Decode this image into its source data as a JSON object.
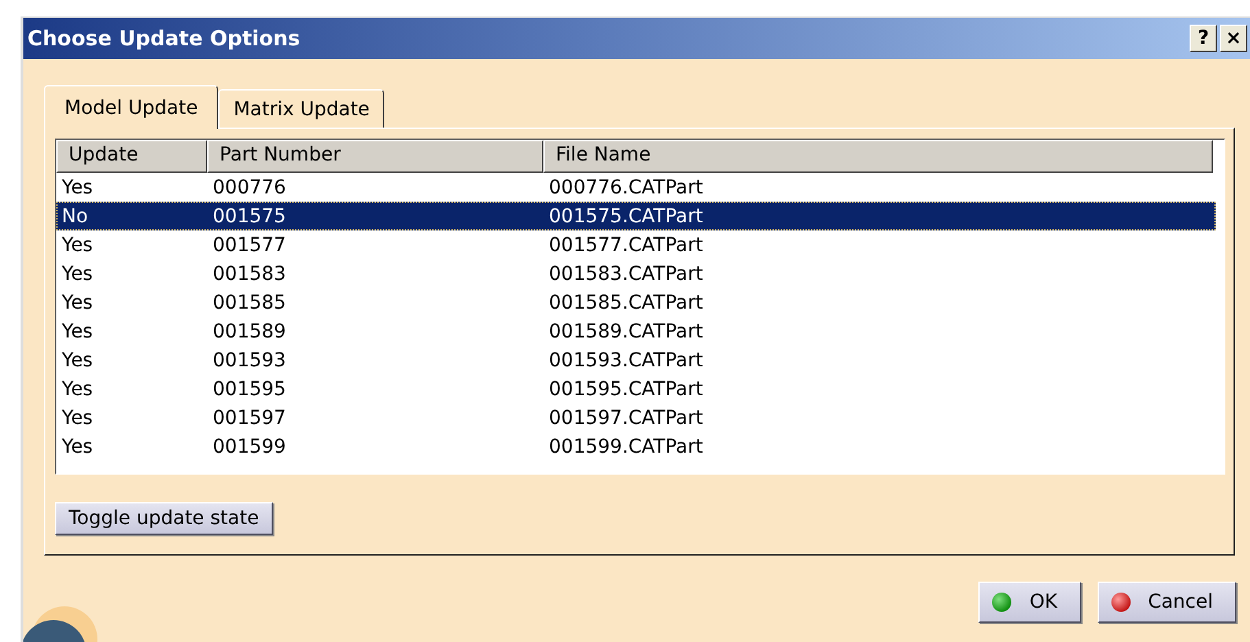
{
  "window": {
    "title": "Choose Update Options",
    "title_buttons": [
      "?",
      "×"
    ]
  },
  "tabs": [
    {
      "label": "Model Update",
      "selected": true
    },
    {
      "label": "Matrix Update",
      "selected": false
    }
  ],
  "table": {
    "columns": [
      "Update",
      "Part Number",
      "File Name"
    ],
    "rows": [
      {
        "cells": [
          "Yes",
          "000776",
          "000776.CATPart"
        ],
        "selected": false
      },
      {
        "cells": [
          "No",
          "001575",
          "001575.CATPart"
        ],
        "selected": true
      },
      {
        "cells": [
          "Yes",
          "001577",
          "001577.CATPart"
        ],
        "selected": false
      },
      {
        "cells": [
          "Yes",
          "001583",
          "001583.CATPart"
        ],
        "selected": false
      },
      {
        "cells": [
          "Yes",
          "001585",
          "001585.CATPart"
        ],
        "selected": false
      },
      {
        "cells": [
          "Yes",
          "001589",
          "001589.CATPart"
        ],
        "selected": false
      },
      {
        "cells": [
          "Yes",
          "001593",
          "001593.CATPart"
        ],
        "selected": false
      },
      {
        "cells": [
          "Yes",
          "001595",
          "001595.CATPart"
        ],
        "selected": false
      },
      {
        "cells": [
          "Yes",
          "001597",
          "001597.CATPart"
        ],
        "selected": false
      },
      {
        "cells": [
          "Yes",
          "001599",
          "001599.CATPart"
        ],
        "selected": false
      }
    ]
  },
  "toggle_button": "Toggle update state",
  "buttons": [
    {
      "label": "OK",
      "kind": "ok"
    },
    {
      "label": "Cancel",
      "kind": "cancel"
    }
  ]
}
